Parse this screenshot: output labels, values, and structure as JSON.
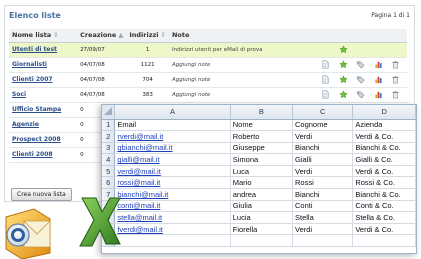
{
  "panel": {
    "title": "Elenco liste",
    "page_info": "Pagina 1 di 1",
    "columns": [
      "Nome lista",
      "Creazione",
      "Indirizzi",
      "Note"
    ],
    "rows": [
      {
        "name": "Utenti di test",
        "date": "27/09/07",
        "count": "1",
        "note": "Indirizzi utenti per eMail di prova"
      },
      {
        "name": "Giornalisti",
        "date": "04/07/08",
        "count": "1121",
        "note": "Aggiungi note"
      },
      {
        "name": "Clienti 2007",
        "date": "04/07/08",
        "count": "704",
        "note": "Aggiungi note"
      },
      {
        "name": "Soci",
        "date": "04/07/08",
        "count": "383",
        "note": "Aggiungi note"
      },
      {
        "name": "Ufficio Stampa",
        "date": "0",
        "count": "",
        "note": ""
      },
      {
        "name": "Agenzie",
        "date": "0",
        "count": "",
        "note": ""
      },
      {
        "name": "Prospect 2008",
        "date": "0",
        "count": "",
        "note": ""
      },
      {
        "name": "Clienti 2008",
        "date": "0",
        "count": "",
        "note": ""
      }
    ],
    "new_list_label": "Crea nuova lista"
  },
  "sheet": {
    "col_headers": [
      "A",
      "B",
      "C",
      "D"
    ],
    "rows": [
      {
        "num": "1",
        "a": "Email",
        "b": "Nome",
        "c": "Cognome",
        "d": "Azienda"
      },
      {
        "num": "2",
        "a": "rverdi@mail.it",
        "b": "Roberto",
        "c": "Verdi",
        "d": "Verdi & Co."
      },
      {
        "num": "3",
        "a": "gbianchi@mail.it",
        "b": "Giuseppe",
        "c": "Bianchi",
        "d": "Bianchi & Co."
      },
      {
        "num": "4",
        "a": "gialli@mail.it",
        "b": "Simona",
        "c": "Gialli",
        "d": "Gialli & Co."
      },
      {
        "num": "5",
        "a": "verdi@mail.it",
        "b": "Luca",
        "c": "Verdi",
        "d": "Verdi & Co."
      },
      {
        "num": "6",
        "a": "rossi@mail.it",
        "b": "Mario",
        "c": "Rossi",
        "d": "Rossi & Co."
      },
      {
        "num": "7",
        "a": "bianchi@mail.it",
        "b": "andrea",
        "c": "Bianchi",
        "d": "Bianchi & Co."
      },
      {
        "num": "8",
        "a": "conti@mail.it",
        "b": "Giulia",
        "c": "Conti",
        "d": "Conti & Co."
      },
      {
        "num": "9",
        "a": "stella@mail.it",
        "b": "Lucia",
        "c": "Stella",
        "d": "Stella & Co."
      },
      {
        "num": "10",
        "a": "fverdi@mail.it",
        "b": "Fiorella",
        "c": "Verdi",
        "d": "Verdi & Co."
      },
      {
        "num": "",
        "a": "",
        "b": "",
        "c": "",
        "d": ""
      }
    ]
  },
  "icons": {
    "row_actions": [
      "document-icon",
      "users-icon",
      "tag-icon",
      "chart-icon",
      "trash-icon"
    ],
    "excel": "excel-icon",
    "outlook": "outlook-icon"
  },
  "colors": {
    "link": "#2a4f8a",
    "highlight_row": "#eef7c8",
    "title": "#4a72a0",
    "email_link": "#1d3fb8",
    "excel_green": "#3d8f2e",
    "outlook_orange": "#f0a020"
  }
}
